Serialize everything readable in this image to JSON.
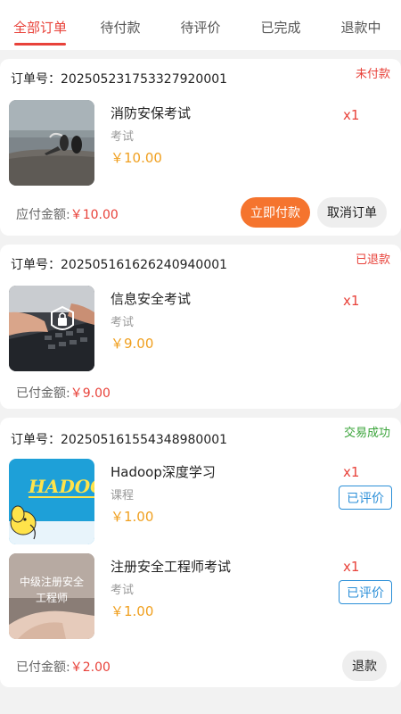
{
  "tabs": [
    {
      "label": "全部订单",
      "active": true
    },
    {
      "label": "待付款",
      "active": false
    },
    {
      "label": "待评价",
      "active": false
    },
    {
      "label": "已完成",
      "active": false
    },
    {
      "label": "退款中",
      "active": false
    }
  ],
  "orders": [
    {
      "order_no": "订单号：20250523175332792000​1",
      "status": "未付款",
      "items": [
        {
          "title": "消防安保考试",
          "category": "考试",
          "price": "￥10.00",
          "qty": "x1",
          "image": "firefighting-photo"
        }
      ],
      "amount_label": "应付金额:",
      "amount_value": "￥10.00",
      "pay_button": "立即付款",
      "cancel_button": "取消订单"
    },
    {
      "order_no": "订单号：20250516162624094000​1",
      "status": "已退款",
      "items": [
        {
          "title": "信息安全考试",
          "category": "考试",
          "price": "￥9.00",
          "qty": "x1",
          "image": "keyboard-security-photo"
        }
      ],
      "amount_label": "已付金额:",
      "amount_value": "￥9.00"
    },
    {
      "order_no": "订单号：20250516155434898000​1",
      "status": "交易成功",
      "items": [
        {
          "title": "Hadoop深度学习",
          "category": "课程",
          "price": "￥1.00",
          "qty": "x1",
          "reviewed": "已评价",
          "image_text": "HADOO"
        },
        {
          "title": "注册安全工程师考试",
          "category": "考试",
          "price": "￥1.00",
          "qty": "x1",
          "reviewed": "已评价",
          "image_text_line1": "中级注册安全",
          "image_text_line2": "工程师"
        }
      ],
      "amount_label": "已付金额:",
      "amount_value": "￥2.00",
      "refund_button": "退款"
    }
  ],
  "colors": {
    "accent": "#e8423a",
    "pay": "#f5742e",
    "price": "#f0a020",
    "success": "#3aa43a",
    "reviewed": "#2b8fd8"
  }
}
